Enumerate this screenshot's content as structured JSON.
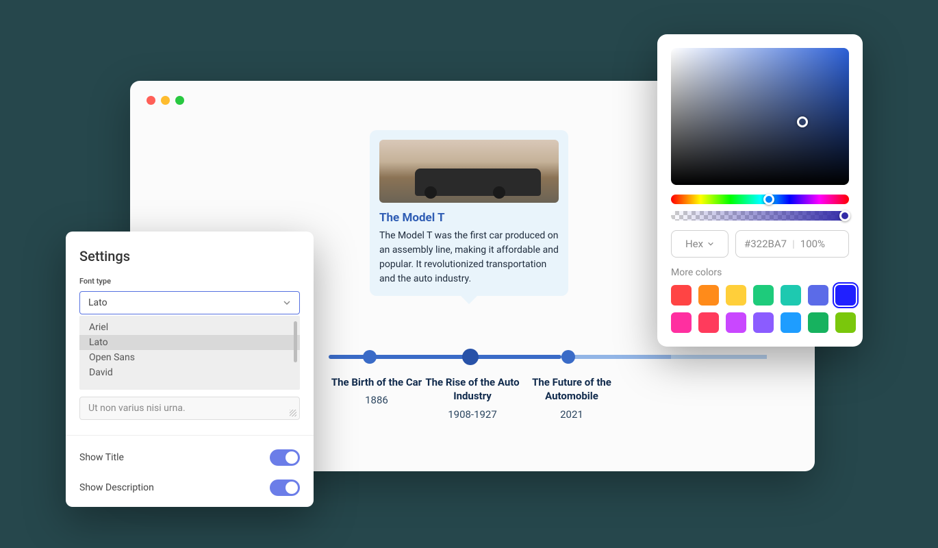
{
  "browser": {
    "card": {
      "title": "The Model T",
      "description": "The Model T was the first car produced on an assembly line, making it affordable and popular. It revolutionized transportation and the auto industry."
    },
    "milestones": [
      {
        "title": "The Birth of the Car",
        "year": "1886"
      },
      {
        "title": "The Rise of the Auto Industry",
        "year": "1908-1927"
      },
      {
        "title": "The Future of the Automobile",
        "year": "2021"
      }
    ]
  },
  "settings": {
    "title": "Settings",
    "font_type_label": "Font type",
    "selected_font": "Lato",
    "font_options": [
      "Ariel",
      "Lato",
      "Open Sans",
      "David"
    ],
    "placeholder_text": "Ut non varius nisi urna.",
    "toggles": {
      "show_title": {
        "label": "Show Title",
        "on": true
      },
      "show_description": {
        "label": "Show Description",
        "on": true
      }
    }
  },
  "color_picker": {
    "format_label": "Hex",
    "hex_value": "#322BA7",
    "alpha_value": "100%",
    "more_colors_label": "More colors",
    "swatches": [
      "#ff4444",
      "#ff8b1a",
      "#ffcf3a",
      "#1ecb7b",
      "#1ec9b0",
      "#5b6be8",
      "#2020ff",
      "#ff2fa0",
      "#ff3b5c",
      "#c947ff",
      "#8b5cff",
      "#1e9dff",
      "#17b25f",
      "#7ac70c"
    ],
    "selected_swatch_index": 6
  }
}
